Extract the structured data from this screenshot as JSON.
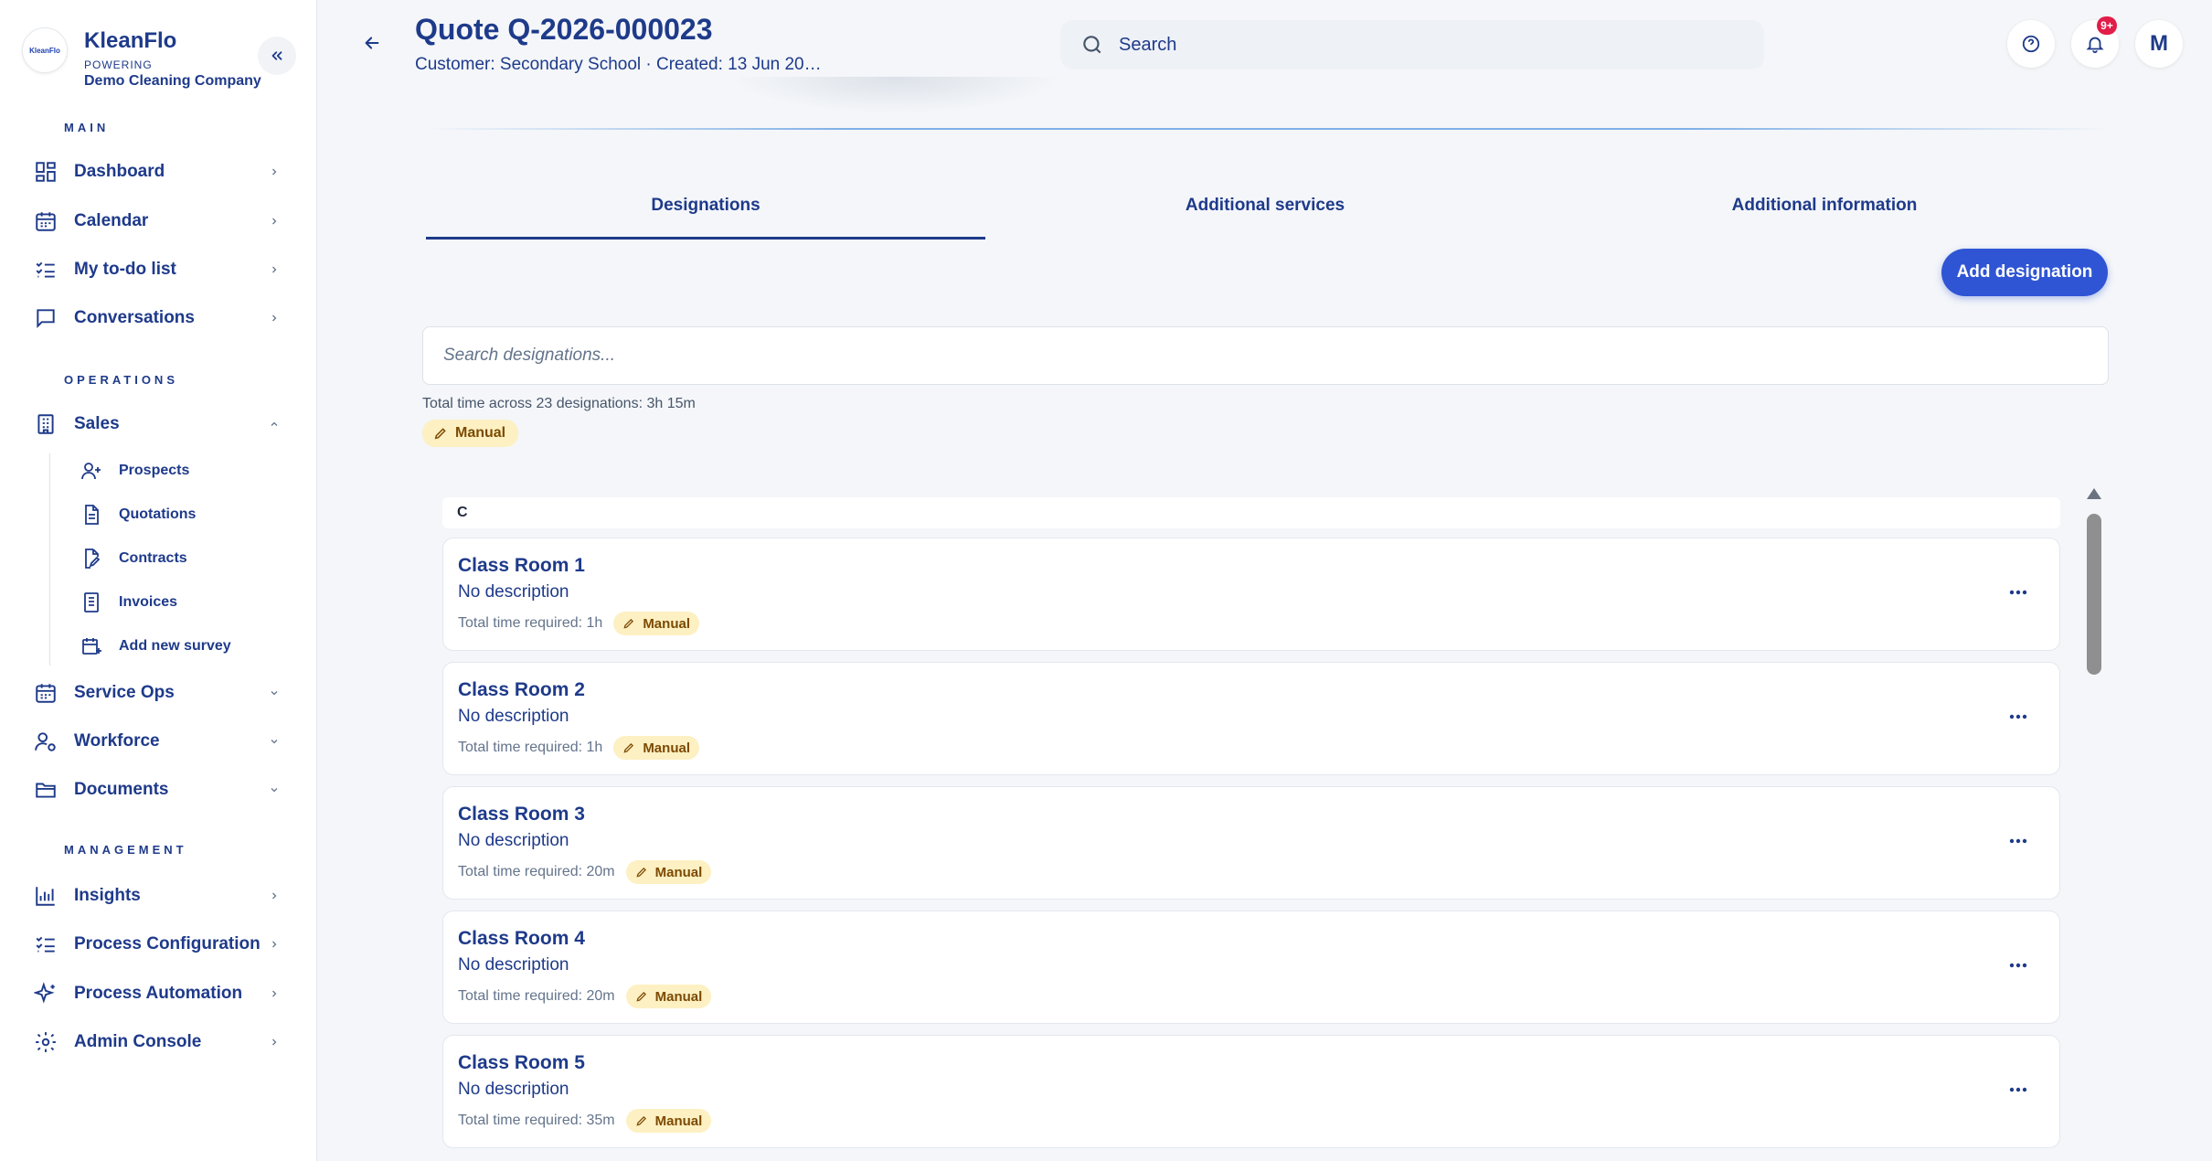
{
  "brand": {
    "name": "KleanFlo",
    "logo_text": "KleanFlo",
    "powering": "POWERING",
    "company": "Demo Cleaning Company"
  },
  "sidebar": {
    "sections": {
      "main": "MAIN",
      "operations": "OPERATIONS",
      "management": "MANAGEMENT"
    },
    "main_items": [
      {
        "label": "Dashboard",
        "icon": "dashboard-icon"
      },
      {
        "label": "Calendar",
        "icon": "calendar-icon"
      },
      {
        "label": "My to-do list",
        "icon": "checklist-icon"
      },
      {
        "label": "Conversations",
        "icon": "chat-icon"
      }
    ],
    "operations_items": [
      {
        "label": "Sales",
        "icon": "building-icon",
        "expanded": true
      },
      {
        "label": "Service Ops",
        "icon": "calendar-icon"
      },
      {
        "label": "Workforce",
        "icon": "user-gear-icon"
      },
      {
        "label": "Documents",
        "icon": "folder-icon"
      }
    ],
    "sales_sub_items": [
      {
        "label": "Prospects",
        "icon": "user-plus-icon"
      },
      {
        "label": "Quotations",
        "icon": "document-icon"
      },
      {
        "label": "Contracts",
        "icon": "document-edit-icon"
      },
      {
        "label": "Invoices",
        "icon": "invoice-icon"
      },
      {
        "label": "Add new survey",
        "icon": "calendar-plus-icon"
      }
    ],
    "management_items": [
      {
        "label": "Insights",
        "icon": "bar-chart-icon"
      },
      {
        "label": "Process Configuration",
        "icon": "checklist-icon"
      },
      {
        "label": "Process Automation",
        "icon": "sparkle-icon"
      },
      {
        "label": "Admin Console",
        "icon": "gear-icon"
      }
    ]
  },
  "header": {
    "title": "Quote Q-2026-000023",
    "subtitle": "Customer: Secondary School · Created: 13 Jun 20…",
    "search_placeholder": "Search",
    "notification_count": "9+",
    "avatar_initial": "M"
  },
  "tabs": [
    {
      "label": "Designations",
      "active": true
    },
    {
      "label": "Additional services",
      "active": false
    },
    {
      "label": "Additional information",
      "active": false
    }
  ],
  "designations": {
    "add_button": "Add designation",
    "search_placeholder": "Search designations...",
    "total_time": "Total time across 23 designations: 3h 15m",
    "mode_badge": "Manual",
    "group_letter": "C",
    "items": [
      {
        "name": "Class Room 1",
        "description": "No description",
        "time": "Total time required: 1h",
        "badge": "Manual"
      },
      {
        "name": "Class Room 2",
        "description": "No description",
        "time": "Total time required: 1h",
        "badge": "Manual"
      },
      {
        "name": "Class Room 3",
        "description": "No description",
        "time": "Total time required: 20m",
        "badge": "Manual"
      },
      {
        "name": "Class Room 4",
        "description": "No description",
        "time": "Total time required: 20m",
        "badge": "Manual"
      },
      {
        "name": "Class Room 5",
        "description": "No description",
        "time": "Total time required: 35m",
        "badge": "Manual"
      }
    ],
    "more_label": "···"
  },
  "colors": {
    "primary": "#1e3a8a",
    "accent_button": "#2f55d4",
    "badge_bg": "#fdf0c2",
    "badge_text": "#7c4a03",
    "notification": "#e11d48"
  }
}
